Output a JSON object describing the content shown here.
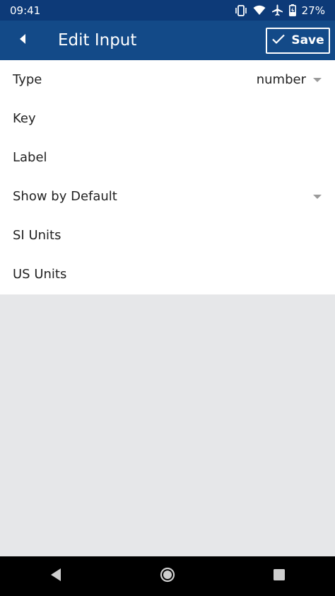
{
  "status_bar": {
    "time": "09:41",
    "battery": "27%",
    "icons": [
      "vibrate-icon",
      "wifi-icon",
      "airplane-icon",
      "battery-charging-icon"
    ]
  },
  "app_bar": {
    "title": "Edit Input",
    "save_label": "Save",
    "color": "#134a88"
  },
  "form": {
    "rows": [
      {
        "label": "Type",
        "value": "number",
        "has_dropdown": true
      },
      {
        "label": "Key",
        "value": "",
        "has_dropdown": false
      },
      {
        "label": "Label",
        "value": "",
        "has_dropdown": false
      },
      {
        "label": "Show by Default",
        "value": "",
        "has_dropdown": true
      },
      {
        "label": "SI Units",
        "value": "",
        "has_dropdown": false
      },
      {
        "label": "US Units",
        "value": "",
        "has_dropdown": false
      }
    ]
  }
}
